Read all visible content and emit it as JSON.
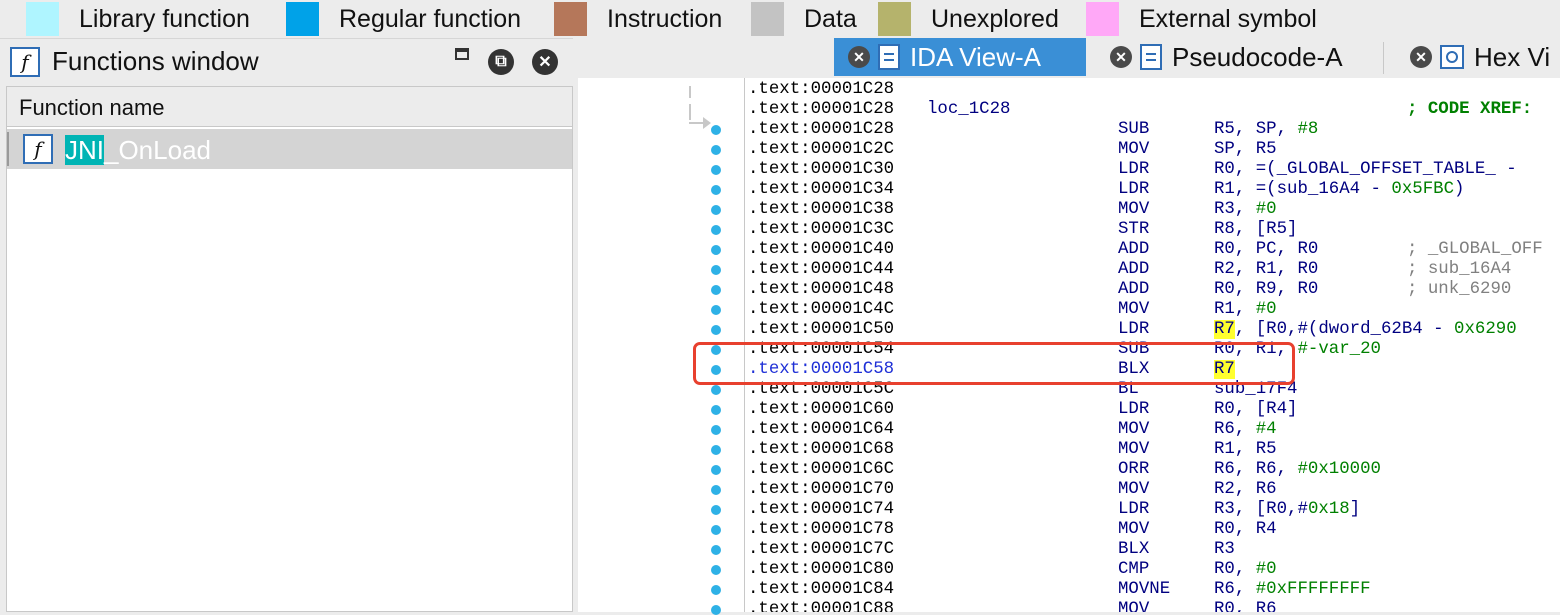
{
  "legend": [
    {
      "label": "Library function",
      "color": "#aff5ff"
    },
    {
      "label": "Regular function",
      "color": "#00a2e8"
    },
    {
      "label": "Instruction",
      "color": "#b5775a"
    },
    {
      "label": "Data",
      "color": "#c3c3c3"
    },
    {
      "label": "Unexplored",
      "color": "#b5b36c"
    },
    {
      "label": "External symbol",
      "color": "#ffa8f7"
    }
  ],
  "functions_window": {
    "icon": "function-f-icon",
    "title": "Functions window",
    "column_header": "Function name",
    "rows": [
      {
        "name_highlight": "JNI",
        "name_rest": "_OnLoad"
      }
    ]
  },
  "tabs": [
    {
      "label": "IDA View-A",
      "icon": "disassembly-doc-icon",
      "active": true
    },
    {
      "label": "Pseudocode-A",
      "icon": "pseudocode-doc-icon",
      "active": false
    },
    {
      "label": "Hex Vi",
      "icon": "hex-view-icon",
      "active": false
    }
  ],
  "code": {
    "lines": [
      {
        "addr": ".text:00001C28"
      },
      {
        "addr": ".text:00001C28",
        "label": "loc_1C28",
        "xref": "; CODE XREF:"
      },
      {
        "addr": ".text:00001C28",
        "mn": "SUB",
        "op": [
          [
            "R5, SP, ",
            ""
          ],
          [
            "#8",
            "num"
          ]
        ]
      },
      {
        "addr": ".text:00001C2C",
        "mn": "MOV",
        "op": [
          [
            "SP, R5",
            ""
          ]
        ]
      },
      {
        "addr": ".text:00001C30",
        "mn": "LDR",
        "op": [
          [
            "R0, =(_GLOBAL_OFFSET_TABLE_ -",
            ""
          ]
        ]
      },
      {
        "addr": ".text:00001C34",
        "mn": "LDR",
        "op": [
          [
            "R1, =(sub_16A4 - ",
            ""
          ],
          [
            "0x5FBC",
            "num"
          ],
          [
            ")",
            ""
          ]
        ]
      },
      {
        "addr": ".text:00001C38",
        "mn": "MOV",
        "op": [
          [
            "R3, ",
            ""
          ],
          [
            "#0",
            "num"
          ]
        ]
      },
      {
        "addr": ".text:00001C3C",
        "mn": "STR",
        "op": [
          [
            "R8, [R5]",
            ""
          ]
        ]
      },
      {
        "addr": ".text:00001C40",
        "mn": "ADD",
        "op": [
          [
            "R0, PC, R0",
            ""
          ]
        ],
        "cmt": "; _GLOBAL_OFF"
      },
      {
        "addr": ".text:00001C44",
        "mn": "ADD",
        "op": [
          [
            "R2, R1, R0",
            ""
          ]
        ],
        "cmt": "; sub_16A4"
      },
      {
        "addr": ".text:00001C48",
        "mn": "ADD",
        "op": [
          [
            "R0, R9, R0",
            ""
          ]
        ],
        "cmt": "; unk_6290"
      },
      {
        "addr": ".text:00001C4C",
        "mn": "MOV",
        "op": [
          [
            "R1, ",
            ""
          ],
          [
            "#0",
            "num"
          ]
        ]
      },
      {
        "addr": ".text:00001C50",
        "mn": "LDR",
        "op": [
          [
            "R7",
            "yel"
          ],
          [
            ", [R0,#(dword_62B4 - ",
            ""
          ],
          [
            "0x6290",
            "num"
          ]
        ]
      },
      {
        "addr": ".text:00001C54",
        "mn": "SUB",
        "op": [
          [
            "R0, R1, ",
            ""
          ],
          [
            "#-var_20",
            "num"
          ]
        ]
      },
      {
        "addr": ".text:00001C58",
        "mn": "BLX",
        "op": [
          [
            "R7",
            "yel"
          ]
        ],
        "selected": true
      },
      {
        "addr": ".text:00001C5C",
        "mn": "BL",
        "op": [
          [
            "sub_17F4",
            ""
          ]
        ]
      },
      {
        "addr": ".text:00001C60",
        "mn": "LDR",
        "op": [
          [
            "R0, [R4]",
            ""
          ]
        ]
      },
      {
        "addr": ".text:00001C64",
        "mn": "MOV",
        "op": [
          [
            "R6, ",
            ""
          ],
          [
            "#4",
            "num"
          ]
        ]
      },
      {
        "addr": ".text:00001C68",
        "mn": "MOV",
        "op": [
          [
            "R1, R5",
            ""
          ]
        ]
      },
      {
        "addr": ".text:00001C6C",
        "mn": "ORR",
        "op": [
          [
            "R6, R6, ",
            ""
          ],
          [
            "#0x10000",
            "num"
          ]
        ]
      },
      {
        "addr": ".text:00001C70",
        "mn": "MOV",
        "op": [
          [
            "R2, R6",
            ""
          ]
        ]
      },
      {
        "addr": ".text:00001C74",
        "mn": "LDR",
        "op": [
          [
            "R3, [R0,#",
            ""
          ],
          [
            "0x18",
            "num"
          ],
          [
            "]",
            ""
          ]
        ]
      },
      {
        "addr": ".text:00001C78",
        "mn": "MOV",
        "op": [
          [
            "R0, R4",
            ""
          ]
        ]
      },
      {
        "addr": ".text:00001C7C",
        "mn": "BLX",
        "op": [
          [
            "R3",
            ""
          ]
        ]
      },
      {
        "addr": ".text:00001C80",
        "mn": "CMP",
        "op": [
          [
            "R0, ",
            ""
          ],
          [
            "#0",
            "num"
          ]
        ]
      },
      {
        "addr": ".text:00001C84",
        "mn": "MOVNE",
        "op": [
          [
            "R6, ",
            ""
          ],
          [
            "#0xFFFFFFFF",
            "num"
          ]
        ]
      },
      {
        "addr": ".text:00001C88",
        "mn": "MOV",
        "op": [
          [
            "R0, R6",
            ""
          ]
        ]
      }
    ]
  }
}
